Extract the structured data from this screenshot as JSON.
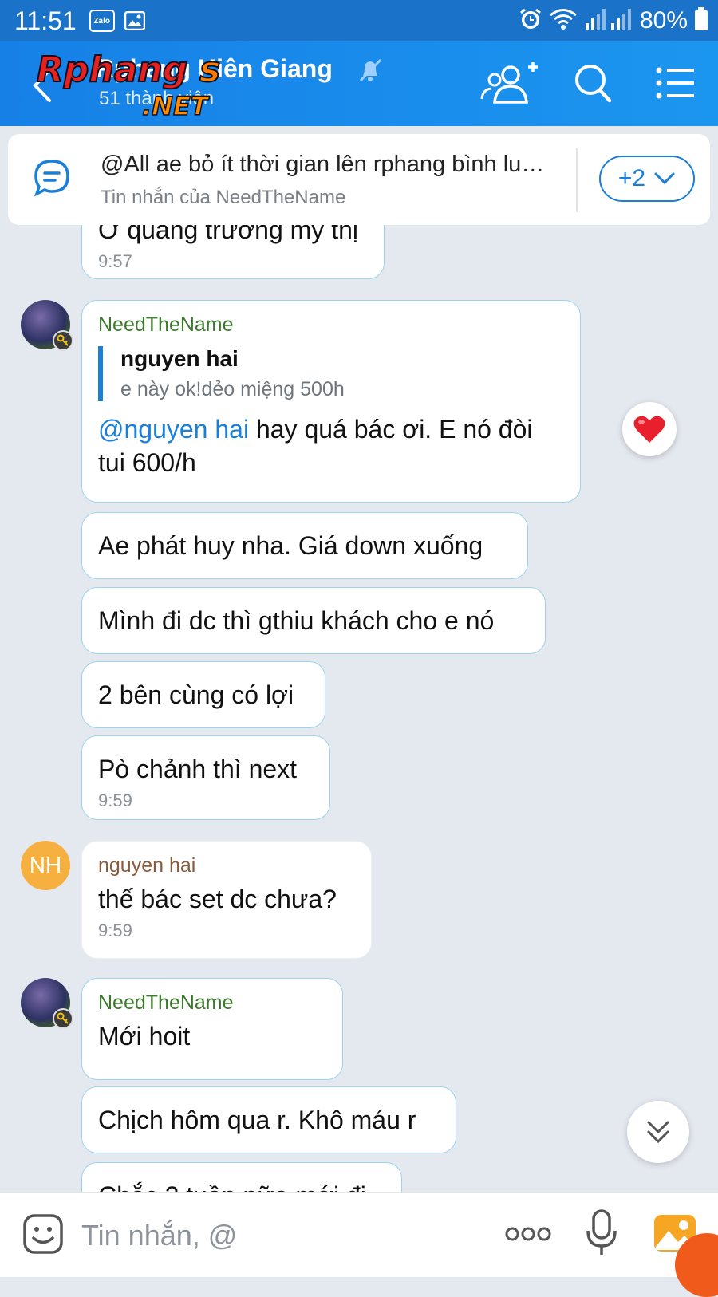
{
  "status_bar": {
    "time": "11:51",
    "zalo_icon_label": "Zalo",
    "battery": "80%"
  },
  "header": {
    "title": "Rphang Kiên Giang",
    "members": "51 thành viên",
    "watermark": "Rphang",
    "watermark_sub": ".NET"
  },
  "pinned": {
    "title": "@All ae bỏ ít thời gian lên rphang bình luận...",
    "subtitle": "Tin nhắn của NeedTheName",
    "more_label": "+2"
  },
  "messages": {
    "m0": {
      "text": "Ở quảng trường mỹ thị",
      "time": "9:57"
    },
    "m1": {
      "sender": "NeedTheName",
      "quote_author": "nguyen hai",
      "quote_text": "e này ok!dẻo miệng 500h",
      "mention": "@nguyen hai",
      "text": " hay quá bác ơi. E nó đòi tui 600/h"
    },
    "m2": {
      "text": "Ae phát huy nha. Giá down xuống"
    },
    "m3": {
      "text": "Mình đi dc thì gthiu khách cho e nó"
    },
    "m4": {
      "text": "2 bên cùng có lợi"
    },
    "m5": {
      "text": "Pò chảnh thì next",
      "time": "9:59"
    },
    "m6": {
      "sender": "nguyen hai",
      "avatar_initials": "NH",
      "text": "thế bác set dc chưa?",
      "time": "9:59"
    },
    "m7": {
      "sender": "NeedTheName",
      "text": "Mới hoit"
    },
    "m8": {
      "text": "Chịch hôm qua r. Khô máu r"
    },
    "m9": {
      "text": "Chắc 2 tuần nữa mới đi"
    }
  },
  "input": {
    "placeholder": "Tin nhắn, @"
  },
  "colors": {
    "header_blue": "#1a73c8",
    "accent": "#1a7fd8",
    "sender_green": "#3a7a2b",
    "sender_brown": "#8a5a3a",
    "avatar_orange": "#f6b040"
  },
  "icons": [
    "zalo-icon",
    "gallery-notification-icon",
    "alarm-icon",
    "wifi-icon",
    "signal-icon",
    "battery-icon",
    "back-icon",
    "mute-bell-icon",
    "add-member-icon",
    "search-icon",
    "menu-icon",
    "pinned-message-icon",
    "chevron-down-icon",
    "heart-reaction-icon",
    "scroll-down-icon",
    "emoji-icon",
    "more-icon",
    "mic-icon",
    "gallery-icon"
  ]
}
